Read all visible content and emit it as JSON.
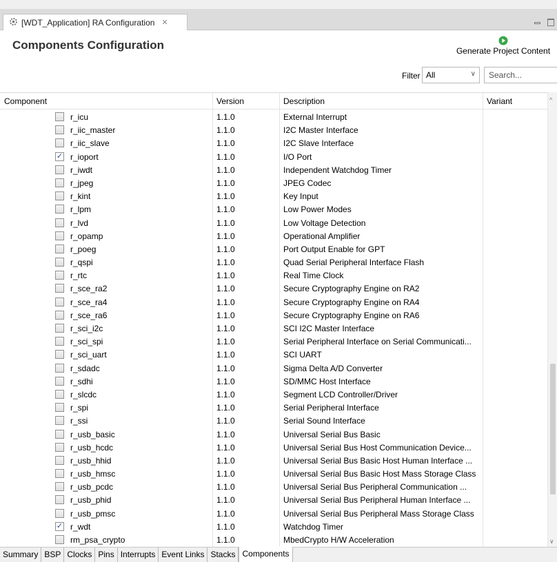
{
  "editor_tab": {
    "title": "[WDT_Application] RA Configuration",
    "close": "✕"
  },
  "page": {
    "title": "Components Configuration"
  },
  "generate": {
    "label": "Generate Project Content"
  },
  "filter": {
    "label": "Filter",
    "selected": "All"
  },
  "search": {
    "placeholder": "Search..."
  },
  "table": {
    "headers": {
      "component": "Component",
      "version": "Version",
      "description": "Description",
      "variant": "Variant"
    },
    "rows": [
      {
        "name": "r_icu",
        "version": "1.1.0",
        "description": "External Interrupt",
        "checked": false
      },
      {
        "name": "r_iic_master",
        "version": "1.1.0",
        "description": "I2C Master Interface",
        "checked": false
      },
      {
        "name": "r_iic_slave",
        "version": "1.1.0",
        "description": "I2C Slave Interface",
        "checked": false
      },
      {
        "name": "r_ioport",
        "version": "1.1.0",
        "description": "I/O Port",
        "checked": true
      },
      {
        "name": "r_iwdt",
        "version": "1.1.0",
        "description": "Independent Watchdog Timer",
        "checked": false
      },
      {
        "name": "r_jpeg",
        "version": "1.1.0",
        "description": "JPEG Codec",
        "checked": false
      },
      {
        "name": "r_kint",
        "version": "1.1.0",
        "description": "Key Input",
        "checked": false
      },
      {
        "name": "r_lpm",
        "version": "1.1.0",
        "description": "Low Power Modes",
        "checked": false
      },
      {
        "name": "r_lvd",
        "version": "1.1.0",
        "description": "Low Voltage Detection",
        "checked": false
      },
      {
        "name": "r_opamp",
        "version": "1.1.0",
        "description": "Operational Amplifier",
        "checked": false
      },
      {
        "name": "r_poeg",
        "version": "1.1.0",
        "description": "Port Output Enable for GPT",
        "checked": false
      },
      {
        "name": "r_qspi",
        "version": "1.1.0",
        "description": "Quad Serial Peripheral Interface Flash",
        "checked": false
      },
      {
        "name": "r_rtc",
        "version": "1.1.0",
        "description": "Real Time Clock",
        "checked": false
      },
      {
        "name": "r_sce_ra2",
        "version": "1.1.0",
        "description": "Secure Cryptography Engine on RA2",
        "checked": false
      },
      {
        "name": "r_sce_ra4",
        "version": "1.1.0",
        "description": "Secure Cryptography Engine on RA4",
        "checked": false
      },
      {
        "name": "r_sce_ra6",
        "version": "1.1.0",
        "description": "Secure Cryptography Engine on RA6",
        "checked": false
      },
      {
        "name": "r_sci_i2c",
        "version": "1.1.0",
        "description": "SCI I2C Master Interface",
        "checked": false
      },
      {
        "name": "r_sci_spi",
        "version": "1.1.0",
        "description": "Serial Peripheral Interface on Serial Communicati...",
        "checked": false
      },
      {
        "name": "r_sci_uart",
        "version": "1.1.0",
        "description": "SCI UART",
        "checked": false
      },
      {
        "name": "r_sdadc",
        "version": "1.1.0",
        "description": "Sigma Delta A/D Converter",
        "checked": false
      },
      {
        "name": "r_sdhi",
        "version": "1.1.0",
        "description": "SD/MMC Host Interface",
        "checked": false
      },
      {
        "name": "r_slcdc",
        "version": "1.1.0",
        "description": "Segment LCD Controller/Driver",
        "checked": false
      },
      {
        "name": "r_spi",
        "version": "1.1.0",
        "description": "Serial Peripheral Interface",
        "checked": false
      },
      {
        "name": "r_ssi",
        "version": "1.1.0",
        "description": "Serial Sound Interface",
        "checked": false
      },
      {
        "name": "r_usb_basic",
        "version": "1.1.0",
        "description": "Universal Serial Bus Basic",
        "checked": false
      },
      {
        "name": "r_usb_hcdc",
        "version": "1.1.0",
        "description": "Universal Serial Bus Host Communication Device...",
        "checked": false
      },
      {
        "name": "r_usb_hhid",
        "version": "1.1.0",
        "description": "Universal Serial Bus Basic Host Human Interface ...",
        "checked": false
      },
      {
        "name": "r_usb_hmsc",
        "version": "1.1.0",
        "description": "Universal Serial Bus Basic Host Mass Storage Class",
        "checked": false
      },
      {
        "name": "r_usb_pcdc",
        "version": "1.1.0",
        "description": "Universal Serial Bus Peripheral Communication ...",
        "checked": false
      },
      {
        "name": "r_usb_phid",
        "version": "1.1.0",
        "description": "Universal Serial Bus Peripheral Human Interface ...",
        "checked": false
      },
      {
        "name": "r_usb_pmsc",
        "version": "1.1.0",
        "description": "Universal Serial Bus Peripheral Mass Storage Class",
        "checked": false
      },
      {
        "name": "r_wdt",
        "version": "1.1.0",
        "description": "Watchdog Timer",
        "checked": true
      },
      {
        "name": "rm_psa_crypto",
        "version": "1.1.0",
        "description": "MbedCrypto H/W Acceleration",
        "checked": false
      }
    ]
  },
  "bottom_tabs": [
    "Summary",
    "BSP",
    "Clocks",
    "Pins",
    "Interrupts",
    "Event Links",
    "Stacks",
    "Components"
  ],
  "active_bottom_tab": "Components",
  "colors": {
    "generate_icon": "#3aa64a",
    "checkmark": "#2b4a8c"
  }
}
